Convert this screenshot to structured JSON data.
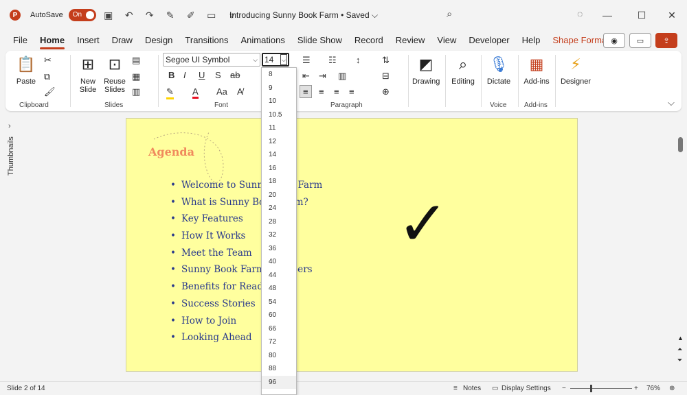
{
  "titlebar": {
    "app_letter": "P",
    "autosave_label": "AutoSave",
    "autosave_state": "On",
    "document_title": "Introducing Sunny Book Farm • Saved ⌵",
    "accent_color": "#c43e1c"
  },
  "tabs": [
    {
      "label": "File"
    },
    {
      "label": "Home"
    },
    {
      "label": "Insert"
    },
    {
      "label": "Draw"
    },
    {
      "label": "Design"
    },
    {
      "label": "Transitions"
    },
    {
      "label": "Animations"
    },
    {
      "label": "Slide Show"
    },
    {
      "label": "Record"
    },
    {
      "label": "Review"
    },
    {
      "label": "View"
    },
    {
      "label": "Developer"
    },
    {
      "label": "Help"
    },
    {
      "label": "Shape Format"
    }
  ],
  "ribbon": {
    "clipboard": {
      "paste": "Paste",
      "label": "Clipboard"
    },
    "slides": {
      "new_slide": "New Slide",
      "reuse_slides": "Reuse Slides",
      "label": "Slides"
    },
    "font": {
      "family": "Segoe UI Symbol",
      "size": "14",
      "label": "Font",
      "bold": "B",
      "italic": "I",
      "underline": "U",
      "strike": "S",
      "case": "Aa"
    },
    "paragraph": {
      "label": "Paragraph"
    },
    "drawing": {
      "label": "Drawing"
    },
    "editing": {
      "label": "Editing"
    },
    "voice": {
      "dictate": "Dictate",
      "label": "Voice"
    },
    "addins": {
      "addins": "Add-ins",
      "label": "Add-ins"
    },
    "designer": {
      "label": "Designer"
    }
  },
  "font_size_list": [
    "8",
    "9",
    "10",
    "10.5",
    "11",
    "12",
    "14",
    "16",
    "18",
    "20",
    "24",
    "28",
    "32",
    "36",
    "40",
    "44",
    "48",
    "54",
    "60",
    "66",
    "72",
    "80",
    "88",
    "96"
  ],
  "thumbnails_label": "Thumbnails",
  "slide": {
    "title": "Agenda",
    "bullets": [
      "Welcome to Sunny Book Farm",
      "What is Sunny Book Farm?",
      "Key Features",
      "How It Works",
      "Meet the Team",
      "Sunny Book Farm Members",
      "Benefits for Readers",
      "Success Stories",
      "How to Join",
      "Looking Ahead"
    ],
    "checkmark": "✓",
    "background_color": "#ffff9e",
    "title_color": "#f08a5d",
    "bullet_color": "#2a3a8c"
  },
  "statusbar": {
    "slide_counter": "Slide 2 of 14",
    "notes": "Notes",
    "display_settings": "Display Settings",
    "zoom_minus": "−",
    "zoom_plus": "+",
    "zoom": "76%"
  }
}
